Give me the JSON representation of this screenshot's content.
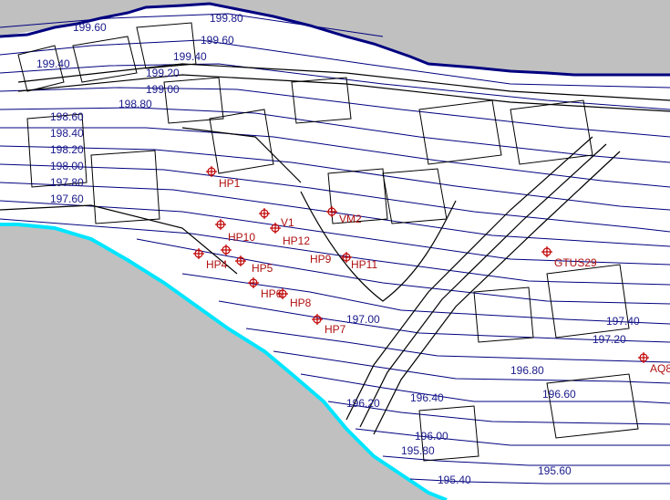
{
  "colors": {
    "background": "#c0c0c0",
    "land": "#ffffff",
    "contour": "#00007f",
    "boundary": "#000080",
    "water_edge": "#00e5ff",
    "building_outline": "#000000",
    "label_text": "#1a1a8c",
    "marker": "#c00000"
  },
  "contour_labels": [
    "199.80",
    "199.60",
    "199.60",
    "199.40",
    "199.40",
    "199.20",
    "199.00",
    "198.80",
    "198.60",
    "198.40",
    "198.20",
    "198.00",
    "197.80",
    "197.60",
    "197.40",
    "197.20",
    "197.00",
    "196.80",
    "196.60",
    "196.40",
    "196.20",
    "196.00",
    "195.80",
    "195.60",
    "195.40"
  ],
  "points": [
    {
      "label": "HP1",
      "icon": "crosshair-marker-icon"
    },
    {
      "label": "HP10",
      "icon": "crosshair-marker-icon"
    },
    {
      "label": "V1",
      "icon": "crosshair-marker-icon"
    },
    {
      "label": "HP12",
      "icon": "crosshair-marker-icon"
    },
    {
      "label": "HP4",
      "icon": "crosshair-marker-icon"
    },
    {
      "label": "HP5",
      "icon": "crosshair-marker-icon"
    },
    {
      "label": "HP6",
      "icon": "crosshair-marker-icon"
    },
    {
      "label": "HP7",
      "icon": "crosshair-marker-icon"
    },
    {
      "label": "HP8",
      "icon": "crosshair-marker-icon"
    },
    {
      "label": "HP9",
      "icon": "crosshair-marker-icon"
    },
    {
      "label": "HP11",
      "icon": "crosshair-marker-icon"
    },
    {
      "label": "VM2",
      "icon": "crosshair-marker-icon"
    },
    {
      "label": "GTUS29",
      "icon": "crosshair-marker-icon"
    },
    {
      "label": "AQ8",
      "icon": "crosshair-marker-icon"
    }
  ]
}
